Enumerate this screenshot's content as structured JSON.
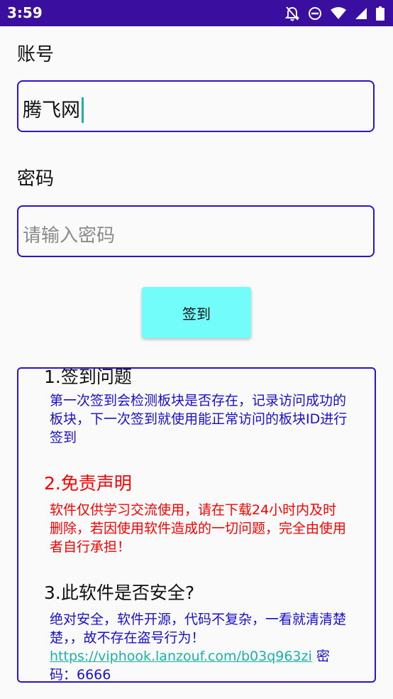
{
  "status_bar": {
    "time": "3:59",
    "icons": [
      "notifications-off-icon",
      "do-not-disturb-icon",
      "wifi-icon",
      "cellular-signal-icon",
      "battery-icon"
    ]
  },
  "form": {
    "account_label": "账号",
    "account_value": "腾飞网",
    "password_label": "密码",
    "password_placeholder": "请输入密码",
    "signin_button": "签到"
  },
  "info": {
    "section1": {
      "title": "1.签到问题",
      "body": "第一次签到会检测板块是否存在，记录访问成功的板块，下一次签到就使用能正常访问的板块ID进行签到"
    },
    "section2": {
      "title": "2.免责声明",
      "body": "软件仅供学习交流使用，请在下载24小时内及时删除，若因使用软件造成的一切问题，完全由使用者自行承担！"
    },
    "section3": {
      "title": "3.此软件是否安全?",
      "body": "绝对安全，软件开源，代码不复杂，一看就清清楚楚，，故不存在盗号行为！",
      "link": "https://viphook.lanzouf.com/b03q963zi",
      "password": "密码：6666"
    }
  },
  "colors": {
    "status_bar": "#3a0fa0",
    "border_blue": "#2a16c8",
    "button_cyan": "#72fdfb",
    "text_blue": "#1a0fd0",
    "text_red": "#ff0000",
    "link_teal": "#18b3a6"
  }
}
